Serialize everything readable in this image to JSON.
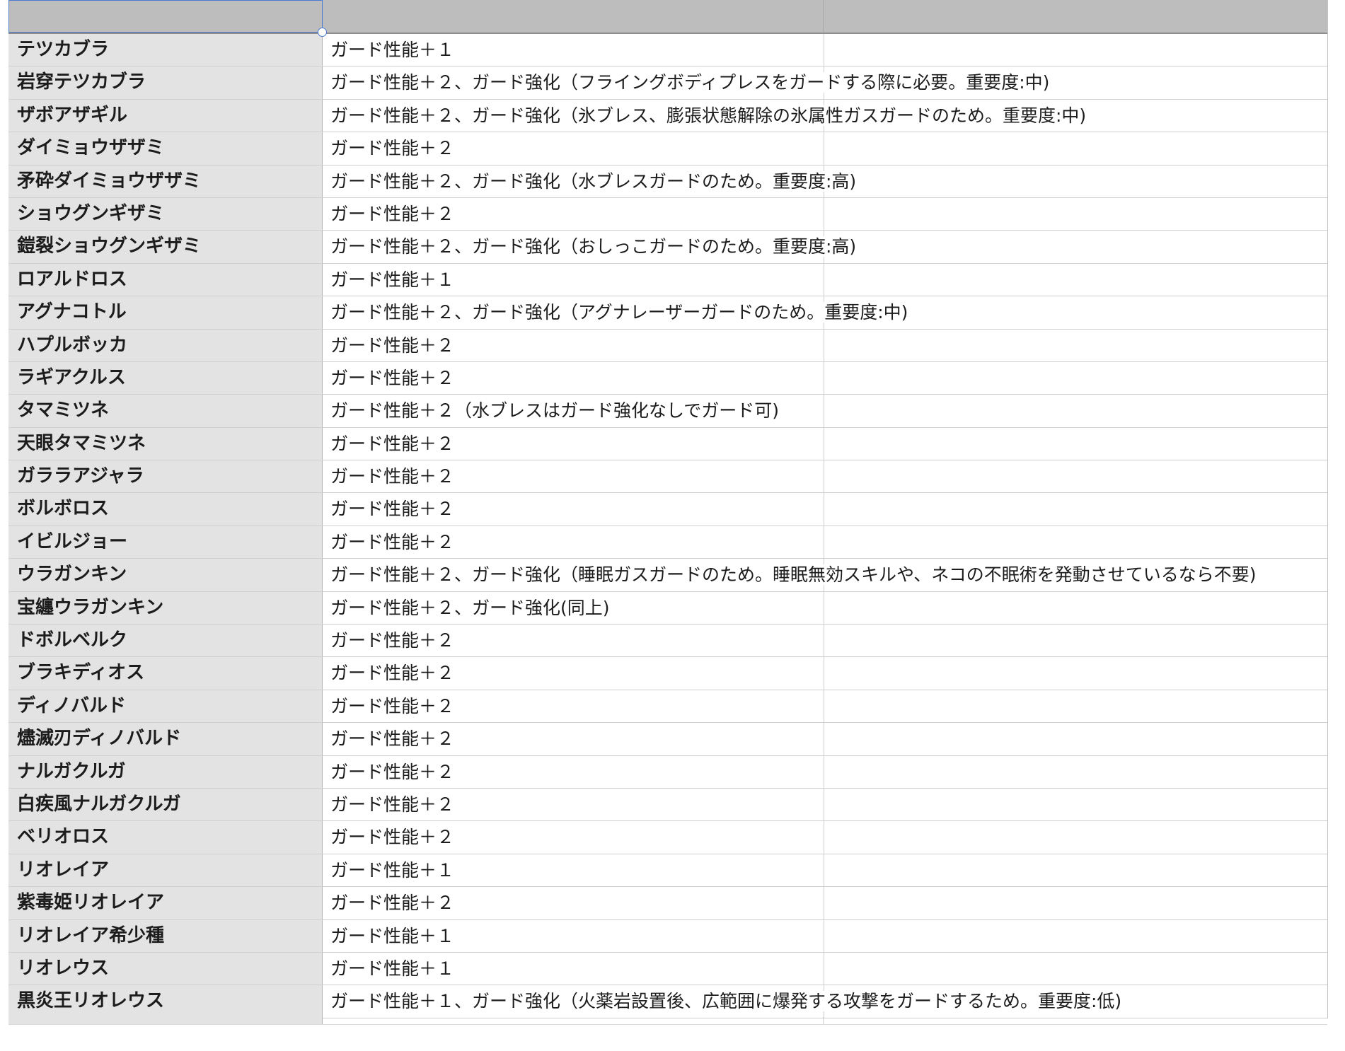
{
  "header": {
    "col_a": "",
    "col_b": "",
    "col_c": ""
  },
  "rows": [
    {
      "name": "テツカブラ",
      "guard": "ガード性能＋１"
    },
    {
      "name": "岩穿テツカブラ",
      "guard": "ガード性能＋２、ガード強化（フライングボディプレスをガードする際に必要。重要度:中)"
    },
    {
      "name": "ザボアザギル",
      "guard": "ガード性能＋２、ガード強化（氷ブレス、膨張状態解除の氷属性ガスガードのため。重要度:中)"
    },
    {
      "name": "ダイミョウザザミ",
      "guard": "ガード性能＋２"
    },
    {
      "name": "矛砕ダイミョウザザミ",
      "guard": "ガード性能＋２、ガード強化（水ブレスガードのため。重要度:高)"
    },
    {
      "name": "ショウグンギザミ",
      "guard": "ガード性能＋２"
    },
    {
      "name": "鎧裂ショウグンギザミ",
      "guard": "ガード性能＋２、ガード強化（おしっこガードのため。重要度:高)"
    },
    {
      "name": "ロアルドロス",
      "guard": "ガード性能＋１"
    },
    {
      "name": "アグナコトル",
      "guard": "ガード性能＋２、ガード強化（アグナレーザーガードのため。重要度:中)"
    },
    {
      "name": "ハプルボッカ",
      "guard": "ガード性能＋２"
    },
    {
      "name": "ラギアクルス",
      "guard": "ガード性能＋２"
    },
    {
      "name": "タマミツネ",
      "guard": "ガード性能＋２（水ブレスはガード強化なしでガード可)"
    },
    {
      "name": "天眼タマミツネ",
      "guard": "ガード性能＋２"
    },
    {
      "name": "ガララアジャラ",
      "guard": "ガード性能＋２"
    },
    {
      "name": "ボルボロス",
      "guard": "ガード性能＋２"
    },
    {
      "name": "イビルジョー",
      "guard": "ガード性能＋２"
    },
    {
      "name": "ウラガンキン",
      "guard": "ガード性能＋２、ガード強化（睡眠ガスガードのため。睡眠無効スキルや、ネコの不眠術を発動させているなら不要)"
    },
    {
      "name": "宝纏ウラガンキン",
      "guard": "ガード性能＋２、ガード強化(同上)"
    },
    {
      "name": "ドボルベルク",
      "guard": "ガード性能＋２"
    },
    {
      "name": "ブラキディオス",
      "guard": "ガード性能＋２"
    },
    {
      "name": "ディノバルド",
      "guard": "ガード性能＋２"
    },
    {
      "name": "燼滅刃ディノバルド",
      "guard": "ガード性能＋２"
    },
    {
      "name": "ナルガクルガ",
      "guard": "ガード性能＋２"
    },
    {
      "name": "白疾風ナルガクルガ",
      "guard": "ガード性能＋２"
    },
    {
      "name": "ベリオロス",
      "guard": "ガード性能＋２"
    },
    {
      "name": "リオレイア",
      "guard": "ガード性能＋１"
    },
    {
      "name": "紫毒姫リオレイア",
      "guard": "ガード性能＋２"
    },
    {
      "name": "リオレイア希少種",
      "guard": "ガード性能＋１"
    },
    {
      "name": "リオレウス",
      "guard": "ガード性能＋１"
    },
    {
      "name": "黒炎王リオレウス",
      "guard": "ガード性能＋１、ガード強化（火薬岩設置後、広範囲に爆発する攻撃をガードするため。重要度:低)"
    }
  ]
}
